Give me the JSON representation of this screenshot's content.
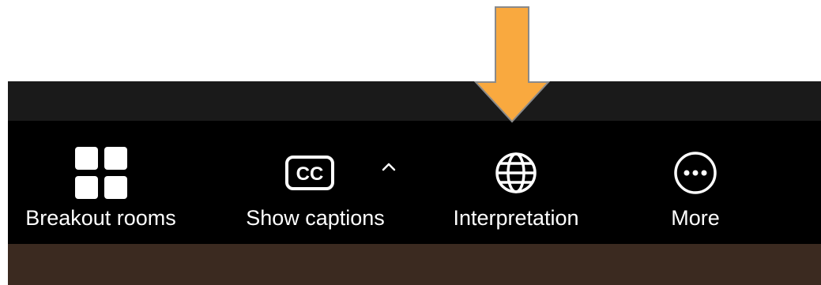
{
  "toolbar": {
    "items": [
      {
        "label": "Breakout rooms",
        "icon": "grid-icon"
      },
      {
        "label": "Show captions",
        "icon": "cc-icon"
      },
      {
        "label": "Interpretation",
        "icon": "globe-icon"
      },
      {
        "label": "More",
        "icon": "more-icon"
      }
    ],
    "captions_options_icon": "chevron-up-icon"
  },
  "colors": {
    "toolbar_bg": "#000000",
    "strip_bg": "#1a1a1a",
    "video_bg": "#3b2a20",
    "icon": "#ffffff",
    "callout_arrow": "#f9a93f",
    "callout_arrow_outline": "#8a8a8a"
  }
}
